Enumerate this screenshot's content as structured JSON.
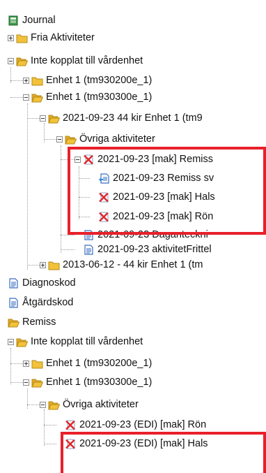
{
  "colors": {
    "highlight_border": "#e8202a",
    "folder": "#f2c23a",
    "document": "#3a6fc0",
    "error_cross": "#e0262b"
  },
  "tree": {
    "nodes": [
      {
        "id": "journal",
        "label": "Journal",
        "icon": "journal-book-icon",
        "expander": "none",
        "level": 0
      },
      {
        "id": "fria",
        "label": "Fria Aktiviteter",
        "icon": "folder-icon",
        "expander": "plus",
        "level": 0
      },
      {
        "id": "inte1",
        "label": "Inte kopplat till vårdenhet",
        "icon": "folder-open-icon",
        "expander": "minus",
        "level": 0
      },
      {
        "id": "enhet1a",
        "label": "Enhet 1 (tm930200e_1)",
        "icon": "folder-icon",
        "expander": "plus",
        "level": 1
      },
      {
        "id": "enhet1b",
        "label": "Enhet 1 (tm930300e_1)",
        "icon": "folder-open-icon",
        "expander": "minus",
        "level": 1
      },
      {
        "id": "kir44",
        "label": "2021-09-23 44 kir Enhet 1 (tm9",
        "icon": "folder-open-icon",
        "expander": "minus",
        "level": 2
      },
      {
        "id": "ovriga1",
        "label": "Övriga aktiviteter",
        "icon": "folder-open-icon",
        "expander": "minus",
        "level": 3
      },
      {
        "id": "remiss_mak",
        "label": "2021-09-23 [mak] Remiss",
        "icon": "red-cross-doc-icon",
        "expander": "minus",
        "level": 4
      },
      {
        "id": "remiss_sv",
        "label": "2021-09-23 Remiss sv",
        "icon": "reply-doc-icon",
        "expander": "none",
        "level": 5
      },
      {
        "id": "hals",
        "label": "2021-09-23 [mak] Hals",
        "icon": "red-cross-doc-icon",
        "expander": "none",
        "level": 5
      },
      {
        "id": "ron",
        "label": "2021-09-23 [mak] Rön",
        "icon": "red-cross-doc-icon",
        "expander": "none",
        "level": 5
      },
      {
        "id": "dagant",
        "label": "2021-09-23 Daganteckni",
        "icon": "document-icon",
        "expander": "none",
        "level": 4
      },
      {
        "id": "aktfrittel",
        "label": "2021-09-23 aktivitetFrittel",
        "icon": "document-icon",
        "expander": "none",
        "level": 4
      },
      {
        "id": "kir2013",
        "label": "2013-06-12 - 44 kir Enhet 1 (tm",
        "icon": "folder-icon",
        "expander": "plus",
        "level": 2
      },
      {
        "id": "diagnoskod",
        "label": "Diagnoskod",
        "icon": "document-icon",
        "expander": "none",
        "level": 0
      },
      {
        "id": "atgardskod",
        "label": "Åtgärdskod",
        "icon": "document-icon",
        "expander": "none",
        "level": 0
      },
      {
        "id": "remiss",
        "label": "Remiss",
        "icon": "folder-open-icon",
        "expander": "none",
        "level": 0
      },
      {
        "id": "inte2",
        "label": "Inte kopplat till vårdenhet",
        "icon": "folder-open-icon",
        "expander": "minus",
        "level": 0
      },
      {
        "id": "enhet2a",
        "label": "Enhet 1 (tm930200e_1)",
        "icon": "folder-icon",
        "expander": "plus",
        "level": 1
      },
      {
        "id": "enhet2b",
        "label": "Enhet 1 (tm930300e_1)",
        "icon": "folder-open-icon",
        "expander": "minus",
        "level": 1
      },
      {
        "id": "ovriga2",
        "label": "Övriga aktiviteter",
        "icon": "folder-open-icon",
        "expander": "minus",
        "level": 2
      },
      {
        "id": "edi_ron",
        "label": "2021-09-23 (EDI) [mak] Rön",
        "icon": "red-cross-doc-icon",
        "expander": "none",
        "level": 3
      },
      {
        "id": "edi_hals",
        "label": "2021-09-23 (EDI) [mak] Hals",
        "icon": "red-cross-doc-icon",
        "expander": "none",
        "level": 3
      }
    ]
  }
}
